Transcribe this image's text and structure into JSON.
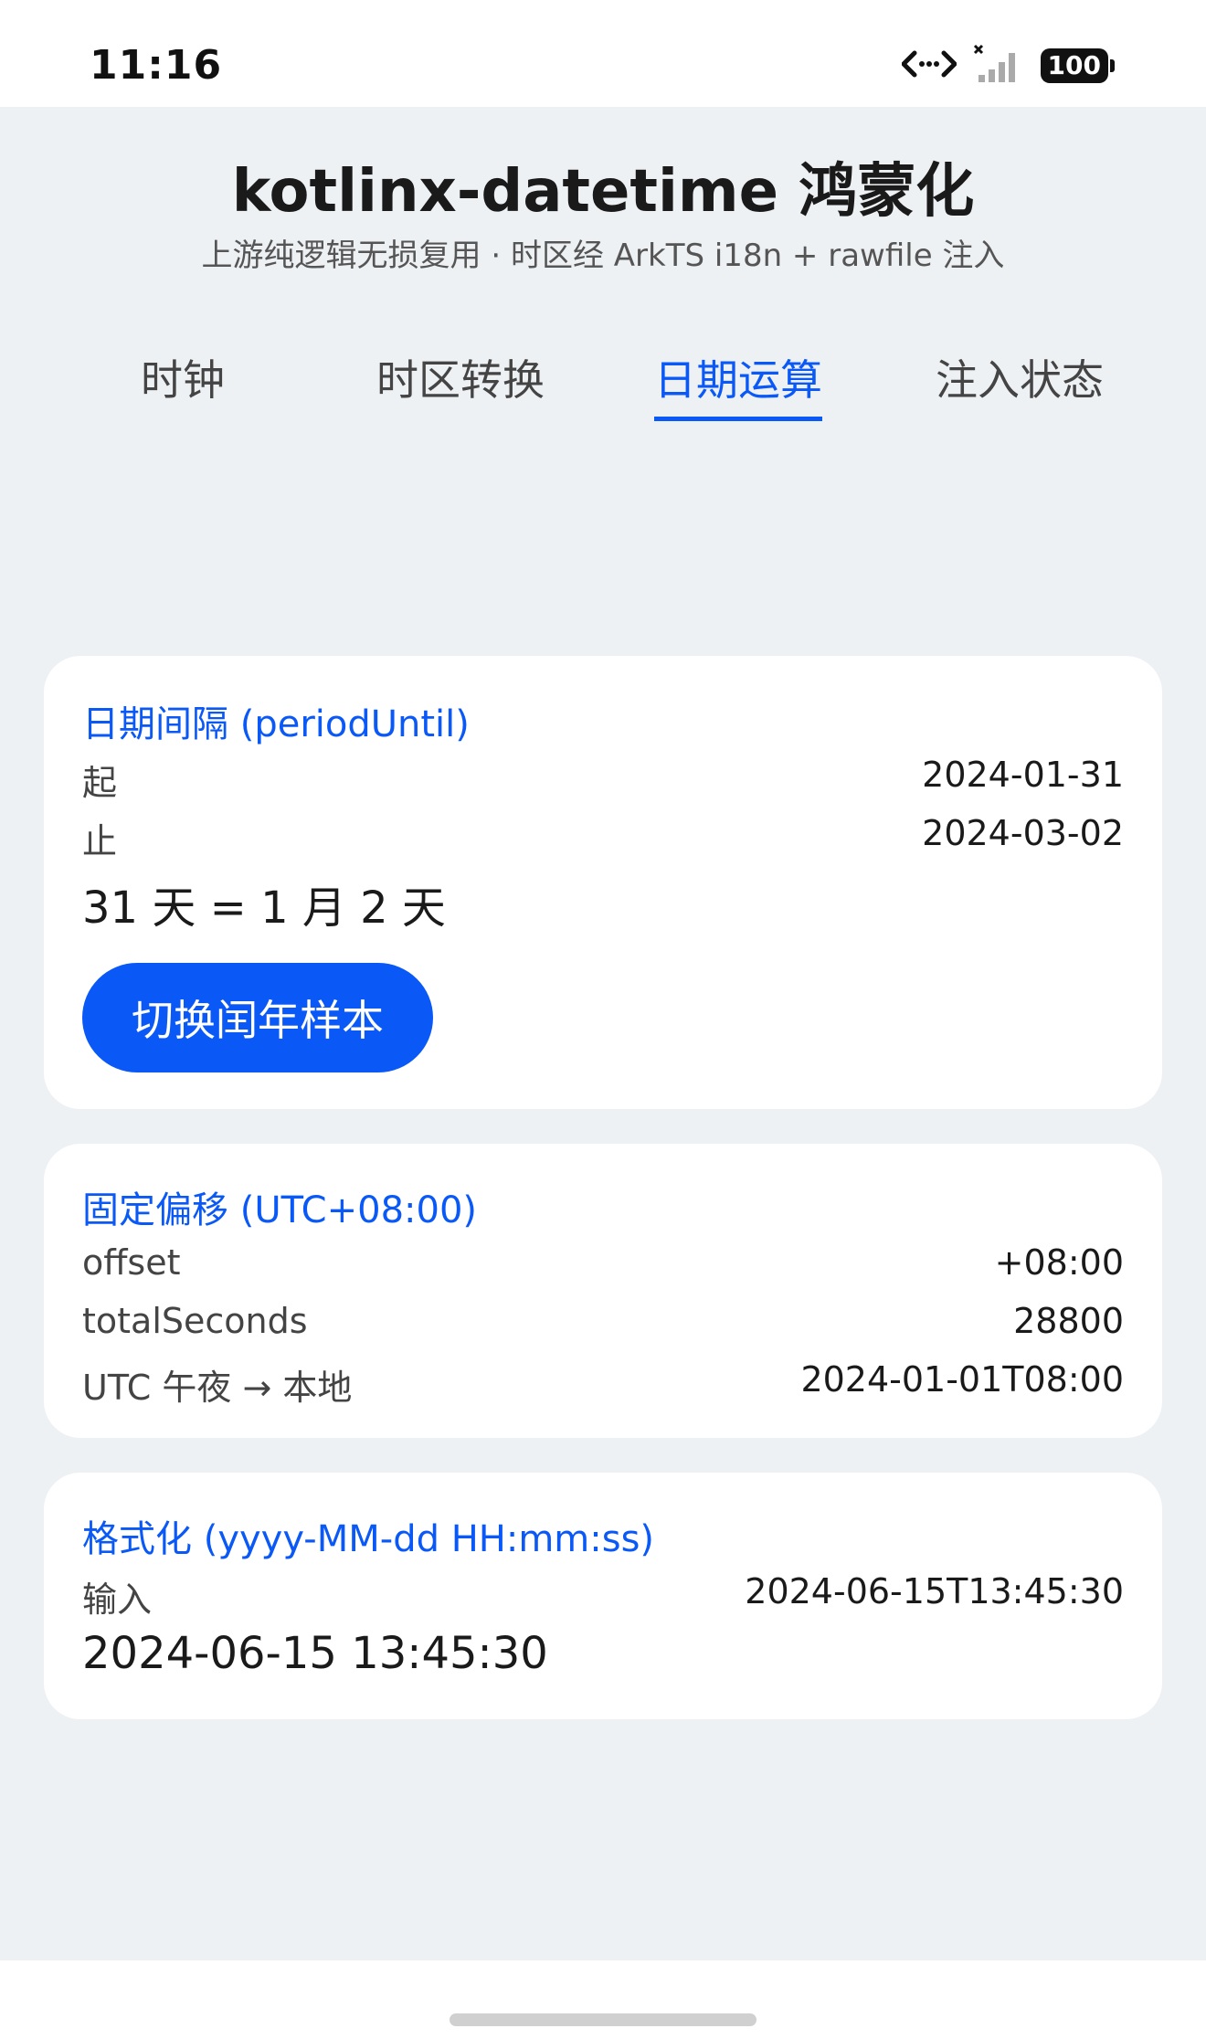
{
  "status_bar": {
    "time": "11:16",
    "battery": "100"
  },
  "header": {
    "title": "kotlinx-datetime 鸿蒙化",
    "subtitle": "上游纯逻辑无损复用 · 时区经 ArkTS i18n + rawfile 注入"
  },
  "tabs": [
    {
      "label": "时钟"
    },
    {
      "label": "时区转换"
    },
    {
      "label": "日期运算",
      "active": true
    },
    {
      "label": "注入状态"
    }
  ],
  "period_card": {
    "title": "日期间隔 (periodUntil)",
    "start_label": "起",
    "start_value": "2024-01-31",
    "end_label": "止",
    "end_value": "2024-03-02",
    "result": "31 天 = 1 月 2 天",
    "button_label": "切换闰年样本"
  },
  "offset_card": {
    "title": "固定偏移 (UTC+08:00)",
    "rows": [
      {
        "label": "offset",
        "value": "+08:00"
      },
      {
        "label": "totalSeconds",
        "value": "28800"
      },
      {
        "label": "UTC 午夜 → 本地",
        "value": "2024-01-01T08:00"
      }
    ]
  },
  "format_card": {
    "title": "格式化 (yyyy-MM-dd HH:mm:ss)",
    "input_label": "输入",
    "input_value": "2024-06-15T13:45:30",
    "result": "2024-06-15 13:45:30"
  },
  "colors": {
    "accent": "#0a59f7",
    "background": "#eef1f4",
    "card": "#ffffff"
  },
  "icons": [
    "network-icon",
    "signal-icon",
    "battery-icon"
  ]
}
